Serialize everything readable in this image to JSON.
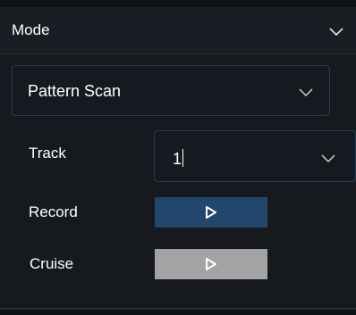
{
  "mode": {
    "title": "Mode",
    "toggle_icon": "chevron-down-icon"
  },
  "pattern_select": {
    "value": "Pattern Scan",
    "icon": "chevron-down-icon"
  },
  "track": {
    "label": "Track",
    "value": "1",
    "icon": "chevron-down-icon"
  },
  "record": {
    "label": "Record",
    "button_icon": "play-icon",
    "button_color": "#23476c"
  },
  "cruise": {
    "label": "Cruise",
    "button_icon": "play-icon",
    "button_color": "#a3a3a3"
  }
}
